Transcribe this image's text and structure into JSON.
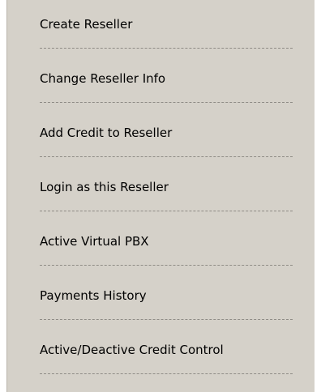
{
  "menu": {
    "items": [
      {
        "label": "Create Reseller"
      },
      {
        "label": "Change Reseller Info"
      },
      {
        "label": "Add Credit to Reseller"
      },
      {
        "label": "Login as this Reseller"
      },
      {
        "label": "Active Virtual PBX"
      },
      {
        "label": "Payments History"
      },
      {
        "label": "Active/Deactive Credit Control"
      }
    ]
  },
  "colors": {
    "panel_background": "#d5d1c9",
    "text": "#000000",
    "divider": "#8f8c86"
  }
}
